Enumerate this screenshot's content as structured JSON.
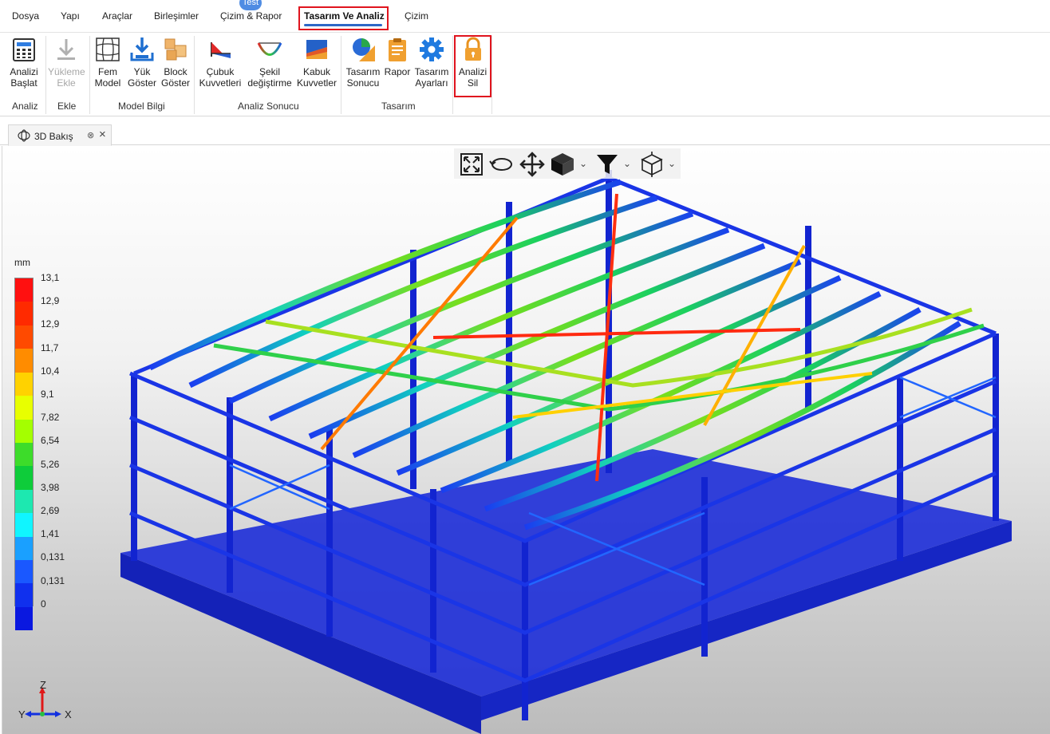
{
  "menu": {
    "badge": "Test",
    "items": [
      "Dosya",
      "Yapı",
      "Araçlar",
      "Birleşimler",
      "Çizim & Rapor",
      "Tasarım Ve Analiz",
      "Çizim"
    ]
  },
  "ribbon": {
    "groups": {
      "analiz": "Analiz",
      "ekle": "Ekle",
      "model_bilgi": "Model Bilgi",
      "analiz_sonucu": "Analiz Sonucu",
      "tasarim": "Tasarım"
    },
    "buttons": {
      "analizi_baslat": [
        "Analizi",
        "Başlat"
      ],
      "yukleme_ekle": [
        "Yükleme",
        "Ekle"
      ],
      "fem_model": [
        "Fem",
        "Model"
      ],
      "yuk_goster": [
        "Yük",
        "Göster"
      ],
      "block_goster": [
        "Block",
        "Göster"
      ],
      "cubuk_kuvvetleri": [
        "Çubuk",
        "Kuvvetleri"
      ],
      "sekil_degistirme": [
        "Şekil",
        "değiştirme"
      ],
      "kabuk_kuvvetler": [
        "Kabuk",
        "Kuvvetler"
      ],
      "tasarim_sonucu": [
        "Tasarım",
        "Sonucu"
      ],
      "rapor": [
        "Rapor",
        ""
      ],
      "tasarim_ayarlari": [
        "Tasarım",
        "Ayarları"
      ],
      "analizi_sil": [
        "Analizi",
        "Sil"
      ]
    }
  },
  "tab": {
    "title": "3D Bakış"
  },
  "legend": {
    "unit": "mm",
    "labels": [
      "13,1",
      "12,9",
      "12,9",
      "11,7",
      "10,4",
      "9,1",
      "7,82",
      "6,54",
      "5,26",
      "3,98",
      "2,69",
      "1,41",
      "0,131",
      "0,131",
      "0"
    ],
    "colors": [
      "#ff1010",
      "#ff2a00",
      "#ff4a00",
      "#ff8c00",
      "#ffd200",
      "#e8ff00",
      "#a4ff00",
      "#3ddc2a",
      "#0ecc3a",
      "#1de8b0",
      "#10f5ff",
      "#1aa0ff",
      "#1a58ff",
      "#1030ee",
      "#0a18e0"
    ]
  },
  "axes": {
    "z": "Z",
    "y": "Y",
    "x": "X"
  },
  "colors": {
    "accent": "#2d67c6",
    "highlight": "#e0141e",
    "structure": "#1420cc"
  }
}
